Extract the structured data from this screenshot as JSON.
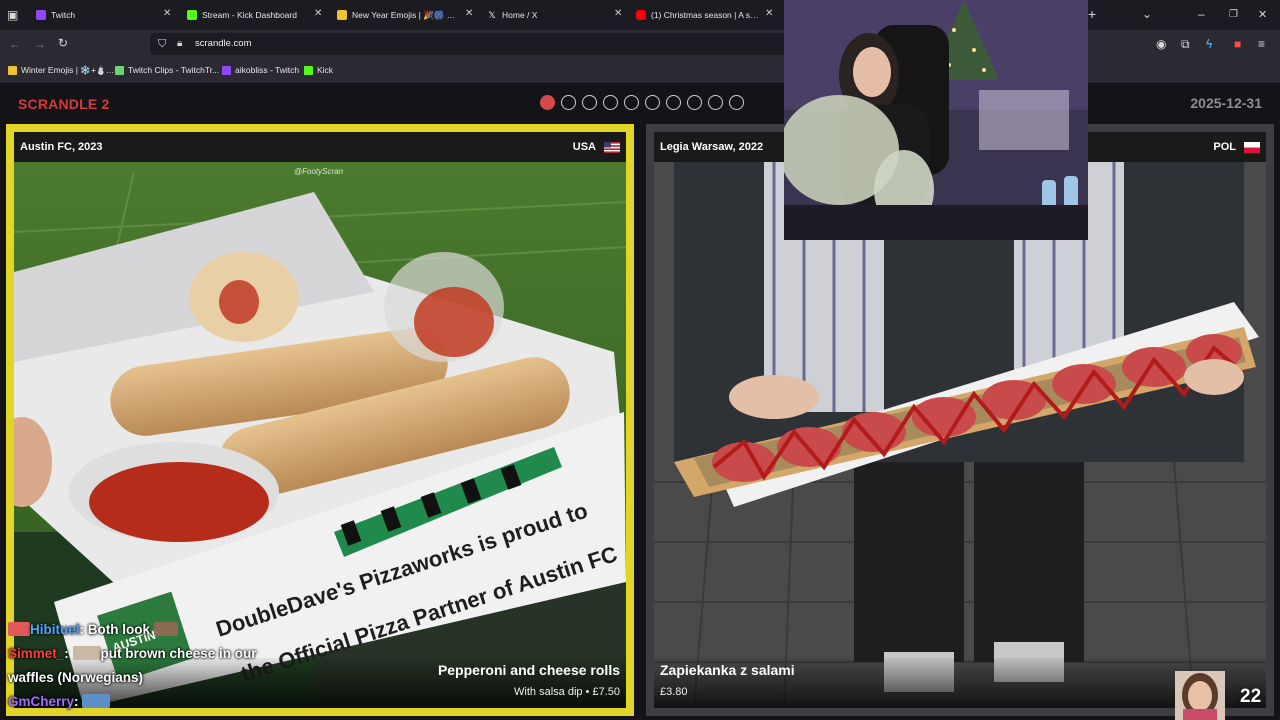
{
  "browser": {
    "tabs": [
      {
        "label": "Twitch",
        "icon": "twitch-icon",
        "color": "#9146ff"
      },
      {
        "label": "Stream - Kick Dashboard",
        "icon": "kick-icon",
        "color": "#53fc18"
      },
      {
        "label": "New Year Emojis | 🎉🎆 🎇 ✨ 🎊",
        "icon": "folder-icon",
        "color": "#f1c232"
      },
      {
        "label": "Home / X",
        "icon": "x-icon",
        "color": "#ffffff"
      },
      {
        "label": "(1) Christmas season | A safe pl",
        "icon": "youtube-icon",
        "color": "#ff0000"
      }
    ],
    "url": "scrandle.com",
    "bookmarks": [
      {
        "label": "Winter Emojis | ❄️+⛄...",
        "icon": "folder-icon",
        "color": "#f1c232"
      },
      {
        "label": "Twitch Clips - TwitchTr...",
        "icon": "twitchtracker-icon",
        "color": "#6fd16f"
      },
      {
        "label": "aikobliss - Twitch",
        "icon": "twitch-icon",
        "color": "#9146ff"
      },
      {
        "label": "Kick",
        "icon": "kick-icon",
        "color": "#53fc18"
      }
    ]
  },
  "game": {
    "logo": "SCRANDLE 2",
    "date": "2025-12-31",
    "progress_total": 10,
    "progress_current": 1,
    "accent_color": "#e2d52a"
  },
  "left_card": {
    "team": "Austin FC, 2023",
    "country": "USA",
    "watermark": "@FootyScran",
    "food_name": "Pepperoni and cheese rolls",
    "food_detail": "With salsa dip • £7.50",
    "box_text_1": "DoubleDave's Pizzaworks is proud to",
    "box_text_2": "the Official Pizza Partner of Austin FC",
    "box_logo": "AUSTIN"
  },
  "right_card": {
    "team": "Legia Warsaw, 2022",
    "country": "POL",
    "food_name": "Zapiekanka z salami",
    "food_detail": "£3.80"
  },
  "chat": [
    {
      "user": "Hibituel",
      "user_color": "#4ea6ff",
      "message": "Both look"
    },
    {
      "user": "Simmet_",
      "user_color": "#ff3b3b",
      "message": "put brown cheese in our"
    },
    {
      "user": "",
      "user_color": "#ffffff",
      "message": "waffles (Norwegians)"
    },
    {
      "user": "GmCherry",
      "user_color": "#a36bff",
      "message": ""
    }
  ],
  "viewer_count": "22"
}
